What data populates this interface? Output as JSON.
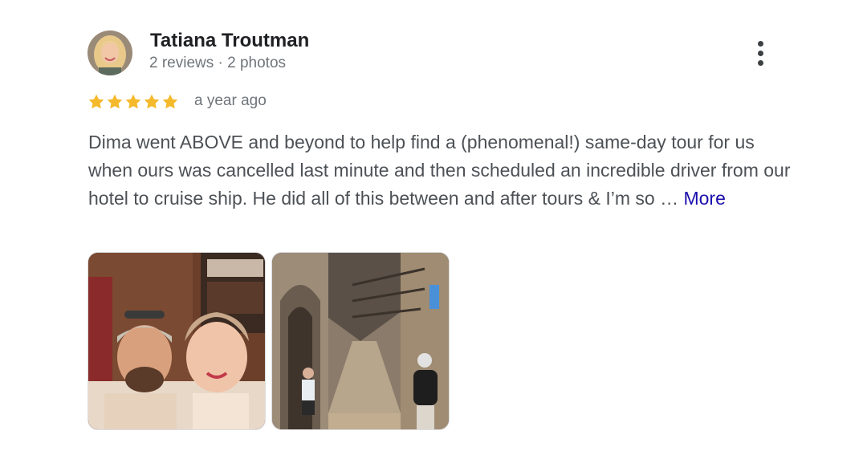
{
  "reviewer": {
    "name": "Tatiana Troutman",
    "meta": "2 reviews · 2 photos"
  },
  "rating": {
    "stars": 5,
    "max": 5,
    "star_color": "#f5b92c"
  },
  "time": "a year ago",
  "review": {
    "text": "Dima went ABOVE and beyond to help find a (phenomenal!) same-day tour for us when ours was cancelled last minute and then scheduled an incredible driver from our hotel to cruise ship. He did all of this between and after tours & I’m so …",
    "more_label": "More"
  },
  "icons": {
    "menu": "more-vert-icon",
    "star": "star-icon"
  },
  "colors": {
    "link": "#1a0dab",
    "secondary_text": "#70757a",
    "body_text": "#4d5156"
  }
}
